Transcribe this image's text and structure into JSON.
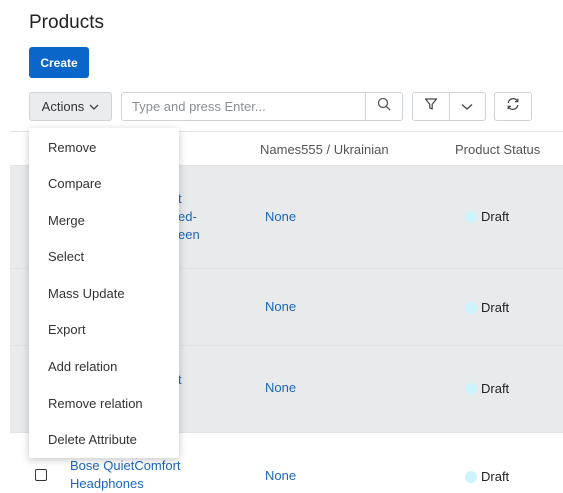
{
  "page": {
    "title": "Products"
  },
  "toolbar": {
    "create_label": "Create",
    "actions_label": "Actions",
    "search_placeholder": "Type and press Enter..."
  },
  "table": {
    "columns": [
      "Names555 / Ukrainian",
      "Product Status"
    ],
    "rows": [
      {
        "name_partial": [
          "t",
          "ed-",
          "een"
        ],
        "ukrainian": "None",
        "status": "Draft"
      },
      {
        "name_partial": [],
        "ukrainian": "None",
        "status": "Draft"
      },
      {
        "name_partial": [
          "t"
        ],
        "ukrainian": "None",
        "status": "Draft"
      },
      {
        "name_partial": [
          "Bose QuietComfort",
          "Headphones"
        ],
        "ukrainian": "None",
        "status": "Draft"
      }
    ]
  },
  "actions_menu": {
    "items": [
      "Remove",
      "Compare",
      "Merge",
      "Select",
      "Mass Update",
      "Export",
      "Add relation",
      "Remove relation",
      "Delete Attribute"
    ]
  },
  "colors": {
    "primary": "#0a66c8",
    "link": "#1b66c0",
    "row_highlight": "#e8eaeb",
    "status_draft": "#cdf4fa"
  }
}
